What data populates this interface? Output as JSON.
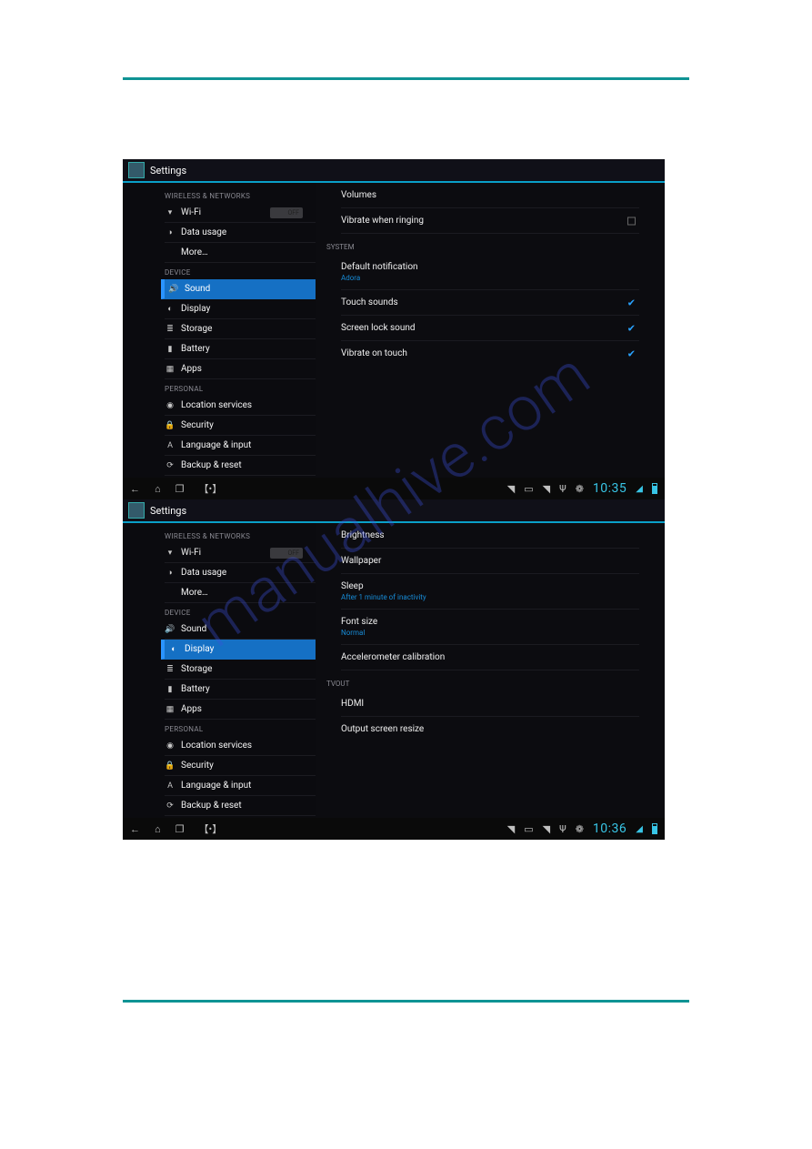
{
  "hr_color": "#0f9394",
  "watermark": "manualhive.com",
  "screens": [
    {
      "header": {
        "title": "Settings"
      },
      "sidebar": {
        "sections": [
          {
            "label": "WIRELESS & NETWORKS",
            "items": [
              {
                "icon": "▾",
                "name": "wifi",
                "label": "Wi-Fi",
                "toggle": "OFF"
              },
              {
                "icon": "◑",
                "name": "data-usage",
                "label": "Data usage"
              },
              {
                "icon": "",
                "name": "more",
                "label": "More…"
              }
            ]
          },
          {
            "label": "DEVICE",
            "items": [
              {
                "icon": "🔊",
                "name": "sound",
                "label": "Sound",
                "selected": true
              },
              {
                "icon": "◐",
                "name": "display",
                "label": "Display"
              },
              {
                "icon": "≣",
                "name": "storage",
                "label": "Storage"
              },
              {
                "icon": "▮",
                "name": "battery",
                "label": "Battery"
              },
              {
                "icon": "▦",
                "name": "apps",
                "label": "Apps"
              }
            ]
          },
          {
            "label": "PERSONAL",
            "items": [
              {
                "icon": "◉",
                "name": "location-services",
                "label": "Location services"
              },
              {
                "icon": "🔒",
                "name": "security",
                "label": "Security"
              },
              {
                "icon": "A",
                "name": "language-input",
                "label": "Language & input"
              },
              {
                "icon": "⟳",
                "name": "backup-reset",
                "label": "Backup & reset"
              }
            ]
          }
        ]
      },
      "detail": {
        "rows_top": [
          {
            "title": "Volumes"
          },
          {
            "title": "Vibrate when ringing",
            "checkbox": "empty"
          }
        ],
        "section": "SYSTEM",
        "rows_bottom": [
          {
            "title": "Default notification",
            "sub": "Adora"
          },
          {
            "title": "Touch sounds",
            "checked": true
          },
          {
            "title": "Screen lock sound",
            "checked": true
          },
          {
            "title": "Vibrate on touch",
            "checked": true
          }
        ]
      },
      "status": {
        "time": "10:35"
      }
    },
    {
      "header": {
        "title": "Settings"
      },
      "sidebar": {
        "sections": [
          {
            "label": "WIRELESS & NETWORKS",
            "items": [
              {
                "icon": "▾",
                "name": "wifi",
                "label": "Wi-Fi",
                "toggle": "OFF"
              },
              {
                "icon": "◑",
                "name": "data-usage",
                "label": "Data usage"
              },
              {
                "icon": "",
                "name": "more",
                "label": "More…"
              }
            ]
          },
          {
            "label": "DEVICE",
            "items": [
              {
                "icon": "🔊",
                "name": "sound",
                "label": "Sound"
              },
              {
                "icon": "◐",
                "name": "display",
                "label": "Display",
                "selected": true
              },
              {
                "icon": "≣",
                "name": "storage",
                "label": "Storage"
              },
              {
                "icon": "▮",
                "name": "battery",
                "label": "Battery"
              },
              {
                "icon": "▦",
                "name": "apps",
                "label": "Apps"
              }
            ]
          },
          {
            "label": "PERSONAL",
            "items": [
              {
                "icon": "◉",
                "name": "location-services",
                "label": "Location services"
              },
              {
                "icon": "🔒",
                "name": "security",
                "label": "Security"
              },
              {
                "icon": "A",
                "name": "language-input",
                "label": "Language & input"
              },
              {
                "icon": "⟳",
                "name": "backup-reset",
                "label": "Backup & reset"
              }
            ]
          }
        ]
      },
      "detail": {
        "rows_top": [
          {
            "title": "Brightness"
          },
          {
            "title": "Wallpaper"
          },
          {
            "title": "Sleep",
            "sub": "After 1 minute of inactivity"
          },
          {
            "title": "Font size",
            "sub": "Normal"
          },
          {
            "title": "Accelerometer calibration"
          }
        ],
        "section": "TVOUT",
        "rows_bottom": [
          {
            "title": "HDMI"
          },
          {
            "title": "Output screen resize"
          }
        ]
      },
      "status": {
        "time": "10:36"
      }
    }
  ]
}
